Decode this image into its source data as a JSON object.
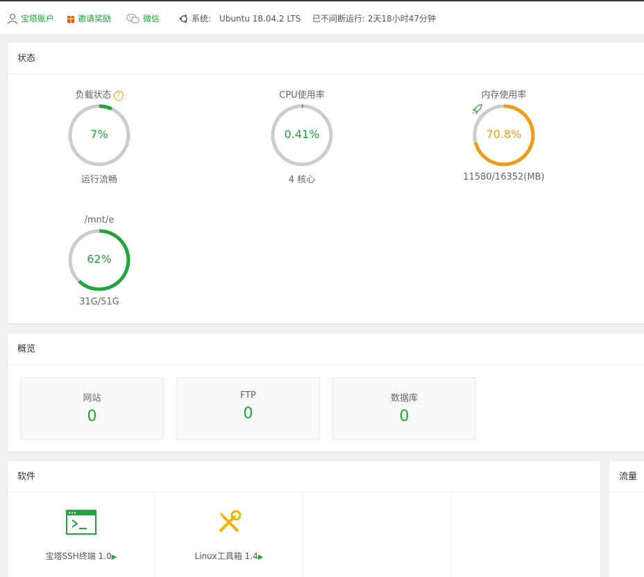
{
  "topbar": {
    "account": "宝塔账户",
    "invite": "邀请奖励",
    "wechat": "微信",
    "system_label": "系统:",
    "system_value": "Ubuntu 18.04.2 LTS",
    "uptime": "已不间断运行: 2天18小时47分钟"
  },
  "status": {
    "title": "状态",
    "gauges": [
      {
        "title": "负载状态",
        "value": "7%",
        "sub": "运行流畅",
        "percent": 7,
        "color": "#20a53a"
      },
      {
        "title": "CPU使用率",
        "value": "0.41%",
        "sub": "4 核心",
        "percent": 0.41,
        "color": "#20a53a"
      },
      {
        "title": "内存使用率",
        "value": "70.8%",
        "sub": "11580/16352(MB)",
        "percent": 70.8,
        "color": "#f39c12"
      },
      {
        "title": "/mnt/e",
        "value": "62%",
        "sub": "31G/51G",
        "percent": 62,
        "color": "#20a53a"
      }
    ]
  },
  "overview": {
    "title": "概览",
    "items": [
      {
        "label": "网站",
        "count": "0"
      },
      {
        "label": "FTP",
        "count": "0"
      },
      {
        "label": "数据库",
        "count": "0"
      }
    ]
  },
  "software": {
    "title": "软件",
    "items": [
      {
        "label": "宝塔SSH终端 1.0",
        "icon": "terminal-icon"
      },
      {
        "label": "Linux工具箱 1.4",
        "icon": "tools-icon"
      }
    ]
  },
  "traffic": {
    "title": "流量"
  },
  "colors": {
    "accent": "#20a53a",
    "warning": "#f39c12",
    "track": "#cccccc"
  }
}
